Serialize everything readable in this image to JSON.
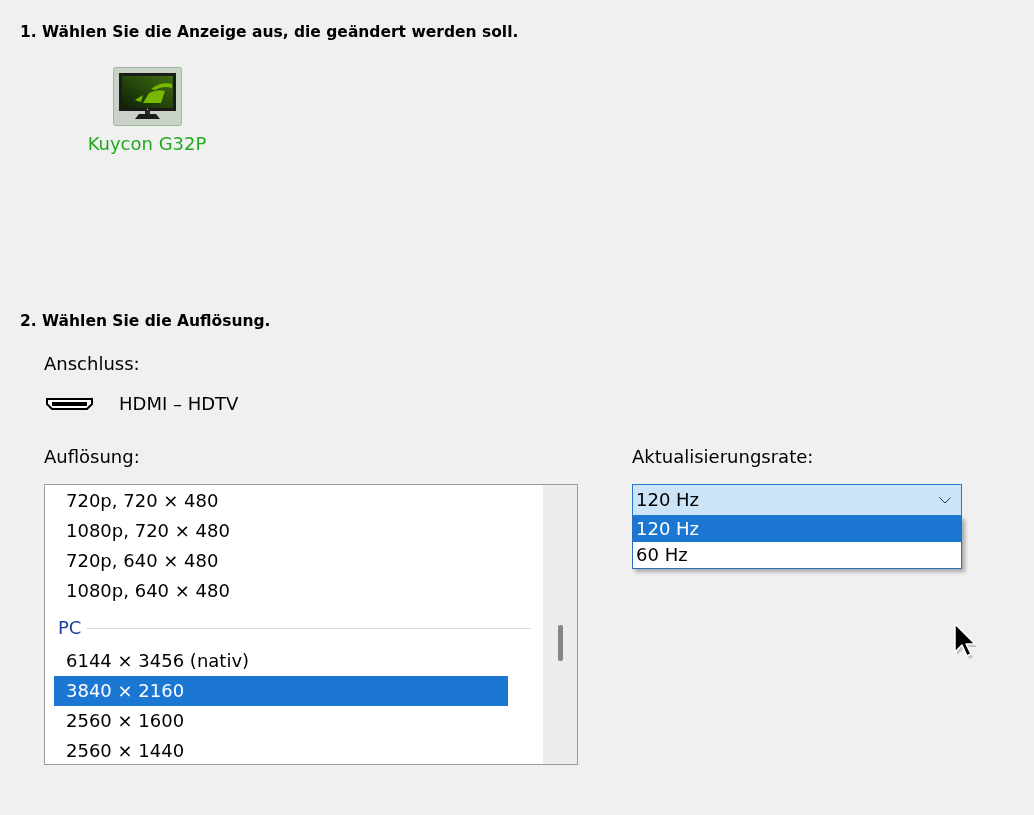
{
  "step_1": {
    "heading": "1. Wählen Sie die Anzeige aus, die geändert werden soll.",
    "displays": [
      {
        "name": "Kuycon G32P",
        "selected": true
      }
    ]
  },
  "step_2": {
    "heading": "2. Wählen Sie die Auflösung.",
    "connection": {
      "label": "Anschluss:",
      "value": "HDMI – HDTV"
    },
    "resolution": {
      "label": "Auflösung:",
      "items": [
        {
          "kind": "option",
          "text": "720p, 720 × 480",
          "selected": false
        },
        {
          "kind": "option",
          "text": "1080p, 720 × 480",
          "selected": false
        },
        {
          "kind": "option",
          "text": "720p, 640 × 480",
          "selected": false
        },
        {
          "kind": "option",
          "text": "1080p, 640 × 480",
          "selected": false
        },
        {
          "kind": "group",
          "text": "PC"
        },
        {
          "kind": "option",
          "text": "6144 × 3456 (nativ)",
          "selected": false
        },
        {
          "kind": "option",
          "text": "3840 × 2160",
          "selected": true
        },
        {
          "kind": "option",
          "text": "2560 × 1600",
          "selected": false
        },
        {
          "kind": "option",
          "text": "2560 × 1440",
          "selected": false
        }
      ]
    },
    "refresh_rate": {
      "label": "Aktualisierungsrate:",
      "value": "120 Hz",
      "expanded": true,
      "options": [
        {
          "text": "120 Hz",
          "selected": true
        },
        {
          "text": "60 Hz",
          "selected": false
        }
      ]
    }
  }
}
